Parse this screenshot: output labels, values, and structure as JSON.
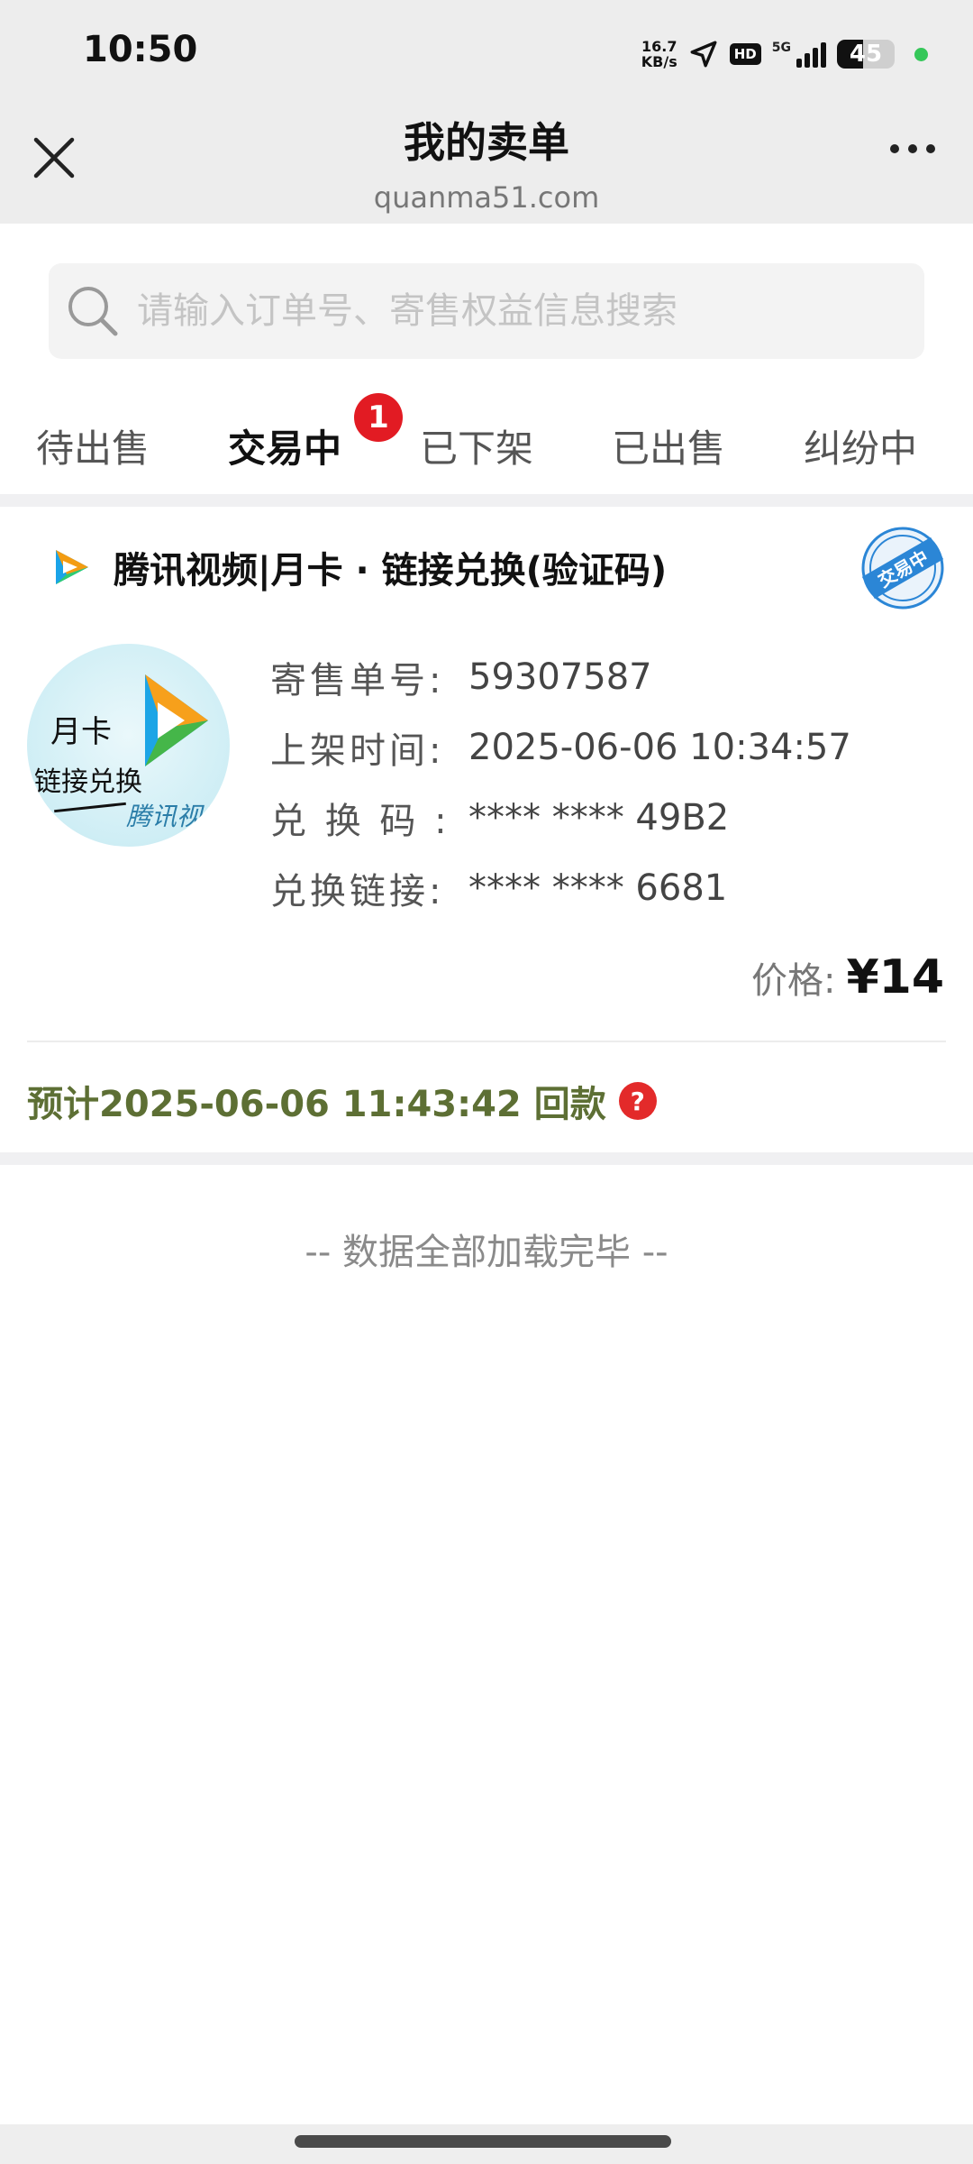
{
  "status_bar": {
    "time": "10:50",
    "net_speed_value": "16.7",
    "net_speed_unit": "KB/s",
    "hd": "HD",
    "network": "5G",
    "battery_level": "45",
    "colors": {
      "battery_dot": "#35c759"
    }
  },
  "header": {
    "title": "我的卖单",
    "subtitle": "quanma51.com",
    "close_icon": "close-icon",
    "more_icon": "more-icon"
  },
  "search": {
    "placeholder": "请输入订单号、寄售权益信息搜索",
    "value": ""
  },
  "tabs": [
    {
      "label": "待出售",
      "active": false
    },
    {
      "label": "交易中",
      "active": true,
      "badge": "1"
    },
    {
      "label": "已下架",
      "active": false
    },
    {
      "label": "已出售",
      "active": false
    },
    {
      "label": "纠纷中",
      "active": false
    }
  ],
  "order": {
    "title": "腾讯视频|月卡 · 链接兑换(验证码)",
    "stamp": "交易中",
    "thumb": {
      "line1": "月卡",
      "line2": "链接兑换",
      "line3": "腾讯视频"
    },
    "fields": [
      {
        "label": "寄售单号:",
        "value": "59307587"
      },
      {
        "label": "上架时间:",
        "value": "2025-06-06 10:34:57"
      },
      {
        "label": "兑 换 码 :",
        "value": "**** **** 49B2"
      },
      {
        "label": "兑换链接:",
        "value": "**** **** 6681"
      }
    ],
    "price_label": "价格:",
    "price_value": "¥14",
    "refund_note": "预计2025-06-06 11:43:42 回款",
    "help": "?",
    "colors": {
      "accent": "#e22026",
      "refund": "#5d6f34",
      "stamp": "#2b86d6"
    }
  },
  "end_note": "-- 数据全部加载完毕 --"
}
